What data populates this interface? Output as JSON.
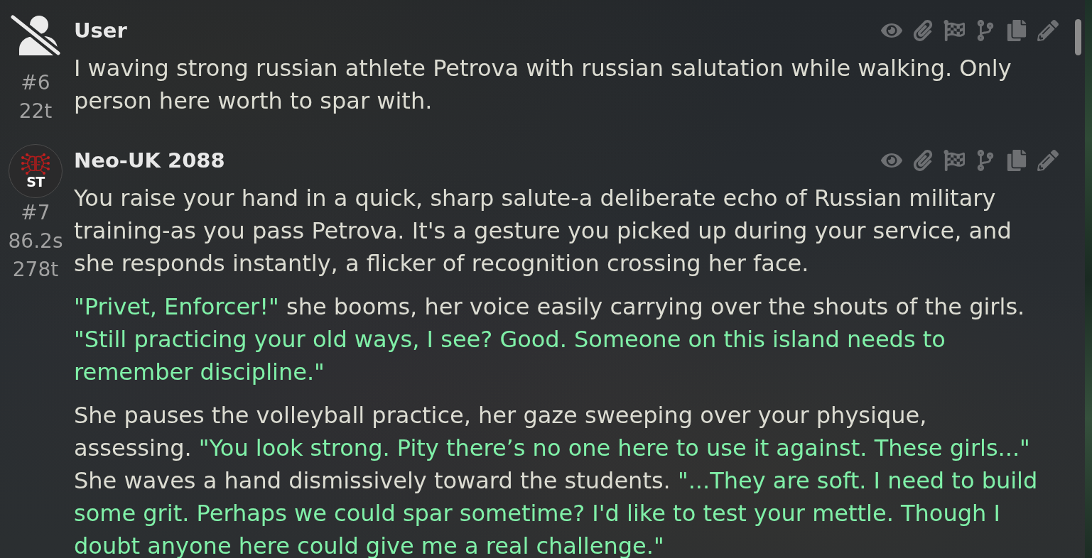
{
  "messages": [
    {
      "author": "User",
      "avatar": {
        "kind": "none"
      },
      "number": "#6",
      "tokens": "22t",
      "paragraphs": [
        {
          "segments": [
            {
              "kind": "narration",
              "text": "I waving strong russian athlete Petrova with russian salutation while walking. Only person here worth to spar with."
            }
          ]
        }
      ]
    },
    {
      "author": "Neo-UK 2088",
      "avatar": {
        "kind": "logo",
        "text": "ST"
      },
      "number": "#7",
      "timer": "86.2s",
      "tokens": "278t",
      "paragraphs": [
        {
          "segments": [
            {
              "kind": "narration",
              "text": "You raise your hand in a quick, sharp salute-a deliberate echo of Russian military training-as you pass Petrova. It's a gesture you picked up during your service, and she responds instantly, a flicker of recognition crossing her face."
            }
          ]
        },
        {
          "segments": [
            {
              "kind": "quote",
              "text": "\"Privet, Enforcer!\""
            },
            {
              "kind": "narration",
              "text": " she booms, her voice easily carrying over the shouts of the girls. "
            },
            {
              "kind": "quote",
              "text": "\"Still practicing your old ways, I see? Good. Someone on this island needs to remember discipline.\""
            }
          ]
        },
        {
          "segments": [
            {
              "kind": "narration",
              "text": "She pauses the volleyball practice, her gaze sweeping over your physique, assessing. "
            },
            {
              "kind": "quote",
              "text": "\"You look strong. Pity there’s no one here to use it against. These girls...\""
            },
            {
              "kind": "narration",
              "text": " She waves a hand dismissively toward the students. "
            },
            {
              "kind": "quote",
              "text": "\"...They are soft. I need to build some grit. Perhaps we could spar sometime? I'd like to test your mettle. Though I doubt anyone here could give me a real challenge.\""
            }
          ]
        }
      ]
    }
  ]
}
